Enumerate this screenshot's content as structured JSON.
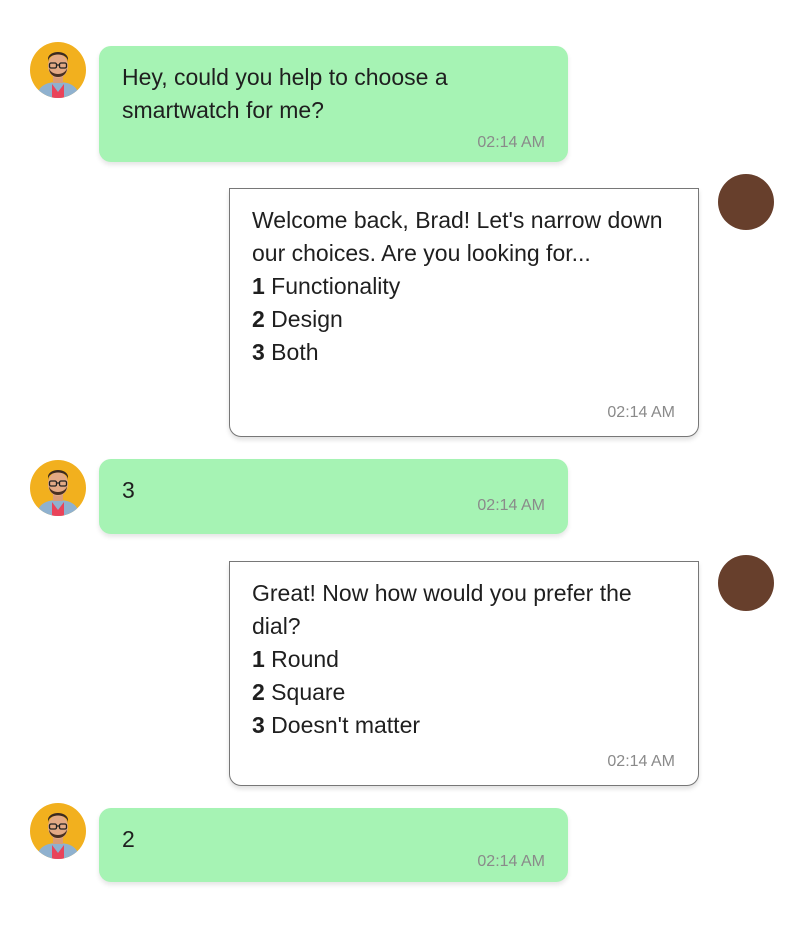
{
  "messages": [
    {
      "from": "user",
      "avatar_icon": "user-avatar-photo-icon",
      "text": "Hey, could you help to choose a smartwatch for me?",
      "time": "02:14 AM"
    },
    {
      "from": "bot",
      "avatar_icon": "bot-avatar-icon",
      "text": "Welcome back, Brad! Let's narrow down our choices. Are you looking for...",
      "options": [
        {
          "num": "1",
          "label": " Functionality"
        },
        {
          "num": "2",
          "label": " Design"
        },
        {
          "num": "3",
          "label": " Both"
        }
      ],
      "time": "02:14 AM"
    },
    {
      "from": "user",
      "avatar_icon": "user-avatar-photo-icon",
      "text": "3",
      "time": "02:14 AM"
    },
    {
      "from": "bot",
      "avatar_icon": "bot-avatar-icon",
      "text": "Great! Now how would you prefer the dial?",
      "options": [
        {
          "num": "1",
          "label": " Round"
        },
        {
          "num": "2",
          "label": " Square"
        },
        {
          "num": "3",
          "label": " Doesn't matter"
        }
      ],
      "time": "02:14 AM"
    },
    {
      "from": "user",
      "avatar_icon": "user-avatar-photo-icon",
      "text": "2",
      "time": "02:14 AM"
    }
  ],
  "colors": {
    "user_bubble": "#a6f3b4",
    "bot_avatar": "#673f2c",
    "timestamp": "#8a8a8a",
    "bot_border": "#777777"
  }
}
